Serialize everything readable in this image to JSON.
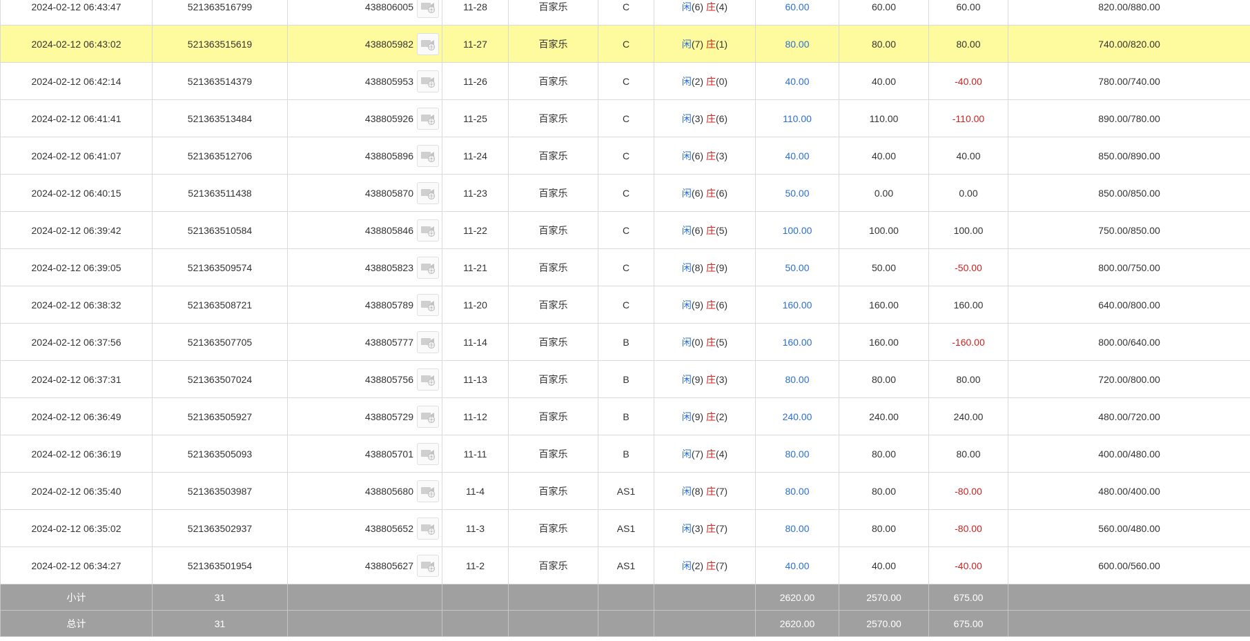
{
  "table": {
    "rows": [
      {
        "time": "2024-02-12 06:43:47",
        "bet_id": "521363516799",
        "order_no": "438806005",
        "shoe_round": "11-28",
        "game": "百家乐",
        "table": "C",
        "player_label": "闲",
        "player_score": "(6)",
        "banker_label": "庄",
        "banker_score": "(4)",
        "bet_amount": "60.00",
        "valid_amount": "60.00",
        "win_loss": "60.00",
        "win_loss_color": "normal",
        "balance": "820.00/880.00",
        "highlight": false
      },
      {
        "time": "2024-02-12 06:43:02",
        "bet_id": "521363515619",
        "order_no": "438805982",
        "shoe_round": "11-27",
        "game": "百家乐",
        "table": "C",
        "player_label": "闲",
        "player_score": "(7)",
        "banker_label": "庄",
        "banker_score": "(1)",
        "bet_amount": "80.00",
        "valid_amount": "80.00",
        "win_loss": "80.00",
        "win_loss_color": "normal",
        "balance": "740.00/820.00",
        "highlight": true
      },
      {
        "time": "2024-02-12 06:42:14",
        "bet_id": "521363514379",
        "order_no": "438805953",
        "shoe_round": "11-26",
        "game": "百家乐",
        "table": "C",
        "player_label": "闲",
        "player_score": "(2)",
        "banker_label": "庄",
        "banker_score": "(0)",
        "bet_amount": "40.00",
        "valid_amount": "40.00",
        "win_loss": "-40.00",
        "win_loss_color": "red",
        "balance": "780.00/740.00",
        "highlight": false
      },
      {
        "time": "2024-02-12 06:41:41",
        "bet_id": "521363513484",
        "order_no": "438805926",
        "shoe_round": "11-25",
        "game": "百家乐",
        "table": "C",
        "player_label": "闲",
        "player_score": "(3)",
        "banker_label": "庄",
        "banker_score": "(6)",
        "bet_amount": "110.00",
        "valid_amount": "110.00",
        "win_loss": "-110.00",
        "win_loss_color": "red",
        "balance": "890.00/780.00",
        "highlight": false
      },
      {
        "time": "2024-02-12 06:41:07",
        "bet_id": "521363512706",
        "order_no": "438805896",
        "shoe_round": "11-24",
        "game": "百家乐",
        "table": "C",
        "player_label": "闲",
        "player_score": "(6)",
        "banker_label": "庄",
        "banker_score": "(3)",
        "bet_amount": "40.00",
        "valid_amount": "40.00",
        "win_loss": "40.00",
        "win_loss_color": "normal",
        "balance": "850.00/890.00",
        "highlight": false
      },
      {
        "time": "2024-02-12 06:40:15",
        "bet_id": "521363511438",
        "order_no": "438805870",
        "shoe_round": "11-23",
        "game": "百家乐",
        "table": "C",
        "player_label": "闲",
        "player_score": "(6)",
        "banker_label": "庄",
        "banker_score": "(6)",
        "bet_amount": "50.00",
        "valid_amount": "0.00",
        "win_loss": "0.00",
        "win_loss_color": "normal",
        "balance": "850.00/850.00",
        "highlight": false
      },
      {
        "time": "2024-02-12 06:39:42",
        "bet_id": "521363510584",
        "order_no": "438805846",
        "shoe_round": "11-22",
        "game": "百家乐",
        "table": "C",
        "player_label": "闲",
        "player_score": "(6)",
        "banker_label": "庄",
        "banker_score": "(5)",
        "bet_amount": "100.00",
        "valid_amount": "100.00",
        "win_loss": "100.00",
        "win_loss_color": "normal",
        "balance": "750.00/850.00",
        "highlight": false
      },
      {
        "time": "2024-02-12 06:39:05",
        "bet_id": "521363509574",
        "order_no": "438805823",
        "shoe_round": "11-21",
        "game": "百家乐",
        "table": "C",
        "player_label": "闲",
        "player_score": "(8)",
        "banker_label": "庄",
        "banker_score": "(9)",
        "bet_amount": "50.00",
        "valid_amount": "50.00",
        "win_loss": "-50.00",
        "win_loss_color": "red",
        "balance": "800.00/750.00",
        "highlight": false
      },
      {
        "time": "2024-02-12 06:38:32",
        "bet_id": "521363508721",
        "order_no": "438805789",
        "shoe_round": "11-20",
        "game": "百家乐",
        "table": "C",
        "player_label": "闲",
        "player_score": "(9)",
        "banker_label": "庄",
        "banker_score": "(6)",
        "bet_amount": "160.00",
        "valid_amount": "160.00",
        "win_loss": "160.00",
        "win_loss_color": "normal",
        "balance": "640.00/800.00",
        "highlight": false
      },
      {
        "time": "2024-02-12 06:37:56",
        "bet_id": "521363507705",
        "order_no": "438805777",
        "shoe_round": "11-14",
        "game": "百家乐",
        "table": "B",
        "player_label": "闲",
        "player_score": "(0)",
        "banker_label": "庄",
        "banker_score": "(5)",
        "bet_amount": "160.00",
        "valid_amount": "160.00",
        "win_loss": "-160.00",
        "win_loss_color": "red",
        "balance": "800.00/640.00",
        "highlight": false
      },
      {
        "time": "2024-02-12 06:37:31",
        "bet_id": "521363507024",
        "order_no": "438805756",
        "shoe_round": "11-13",
        "game": "百家乐",
        "table": "B",
        "player_label": "闲",
        "player_score": "(9)",
        "banker_label": "庄",
        "banker_score": "(3)",
        "bet_amount": "80.00",
        "valid_amount": "80.00",
        "win_loss": "80.00",
        "win_loss_color": "normal",
        "balance": "720.00/800.00",
        "highlight": false
      },
      {
        "time": "2024-02-12 06:36:49",
        "bet_id": "521363505927",
        "order_no": "438805729",
        "shoe_round": "11-12",
        "game": "百家乐",
        "table": "B",
        "player_label": "闲",
        "player_score": "(9)",
        "banker_label": "庄",
        "banker_score": "(2)",
        "bet_amount": "240.00",
        "valid_amount": "240.00",
        "win_loss": "240.00",
        "win_loss_color": "normal",
        "balance": "480.00/720.00",
        "highlight": false
      },
      {
        "time": "2024-02-12 06:36:19",
        "bet_id": "521363505093",
        "order_no": "438805701",
        "shoe_round": "11-11",
        "game": "百家乐",
        "table": "B",
        "player_label": "闲",
        "player_score": "(7)",
        "banker_label": "庄",
        "banker_score": "(4)",
        "bet_amount": "80.00",
        "valid_amount": "80.00",
        "win_loss": "80.00",
        "win_loss_color": "normal",
        "balance": "400.00/480.00",
        "highlight": false
      },
      {
        "time": "2024-02-12 06:35:40",
        "bet_id": "521363503987",
        "order_no": "438805680",
        "shoe_round": "11-4",
        "game": "百家乐",
        "table": "AS1",
        "player_label": "闲",
        "player_score": "(8)",
        "banker_label": "庄",
        "banker_score": "(7)",
        "bet_amount": "80.00",
        "valid_amount": "80.00",
        "win_loss": "-80.00",
        "win_loss_color": "red",
        "balance": "480.00/400.00",
        "highlight": false
      },
      {
        "time": "2024-02-12 06:35:02",
        "bet_id": "521363502937",
        "order_no": "438805652",
        "shoe_round": "11-3",
        "game": "百家乐",
        "table": "AS1",
        "player_label": "闲",
        "player_score": "(3)",
        "banker_label": "庄",
        "banker_score": "(7)",
        "bet_amount": "80.00",
        "valid_amount": "80.00",
        "win_loss": "-80.00",
        "win_loss_color": "red",
        "balance": "560.00/480.00",
        "highlight": false
      },
      {
        "time": "2024-02-12 06:34:27",
        "bet_id": "521363501954",
        "order_no": "438805627",
        "shoe_round": "11-2",
        "game": "百家乐",
        "table": "AS1",
        "player_label": "闲",
        "player_score": "(2)",
        "banker_label": "庄",
        "banker_score": "(7)",
        "bet_amount": "40.00",
        "valid_amount": "40.00",
        "win_loss": "-40.00",
        "win_loss_color": "red",
        "balance": "600.00/560.00",
        "highlight": false
      }
    ],
    "subtotal": {
      "label": "小计",
      "count": "31",
      "bet_amount": "2620.00",
      "valid_amount": "2570.00",
      "win_loss": "675.00"
    },
    "total": {
      "label": "总计",
      "count": "31",
      "bet_amount": "2620.00",
      "valid_amount": "2570.00",
      "win_loss": "675.00"
    }
  },
  "icons": {
    "replay": "video-replay-icon"
  },
  "colors": {
    "highlight_row": "#fdfb9d",
    "player": "#2a6fd6",
    "banker": "#d11f1f",
    "loss": "#d11f1f",
    "summary_bg": "#a0a0a0"
  }
}
